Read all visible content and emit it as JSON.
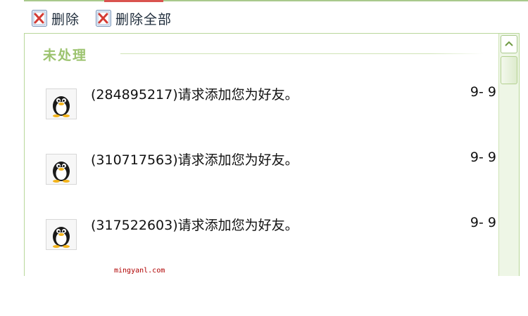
{
  "toolbar": {
    "delete_label": "删除",
    "delete_all_label": "删除全部"
  },
  "section": {
    "title": "未处理"
  },
  "requests": [
    {
      "message": "(284895217)请求添加您为好友。",
      "date": "9- 9"
    },
    {
      "message": "(310717563)请求添加您为好友。",
      "date": "9- 9"
    },
    {
      "message": "(317522603)请求添加您为好友。",
      "date": "9- 9"
    }
  ],
  "watermark": "mingyanl.com",
  "colors": {
    "section_title": "#9cc36f",
    "panel_border": "#b9d79a",
    "delete_icon_accent": "#d9534f"
  },
  "icons": {
    "delete": "delete-icon",
    "delete_all": "delete-all-icon",
    "avatar": "penguin-avatar-icon",
    "scroll_up": "chevron-up-icon"
  }
}
